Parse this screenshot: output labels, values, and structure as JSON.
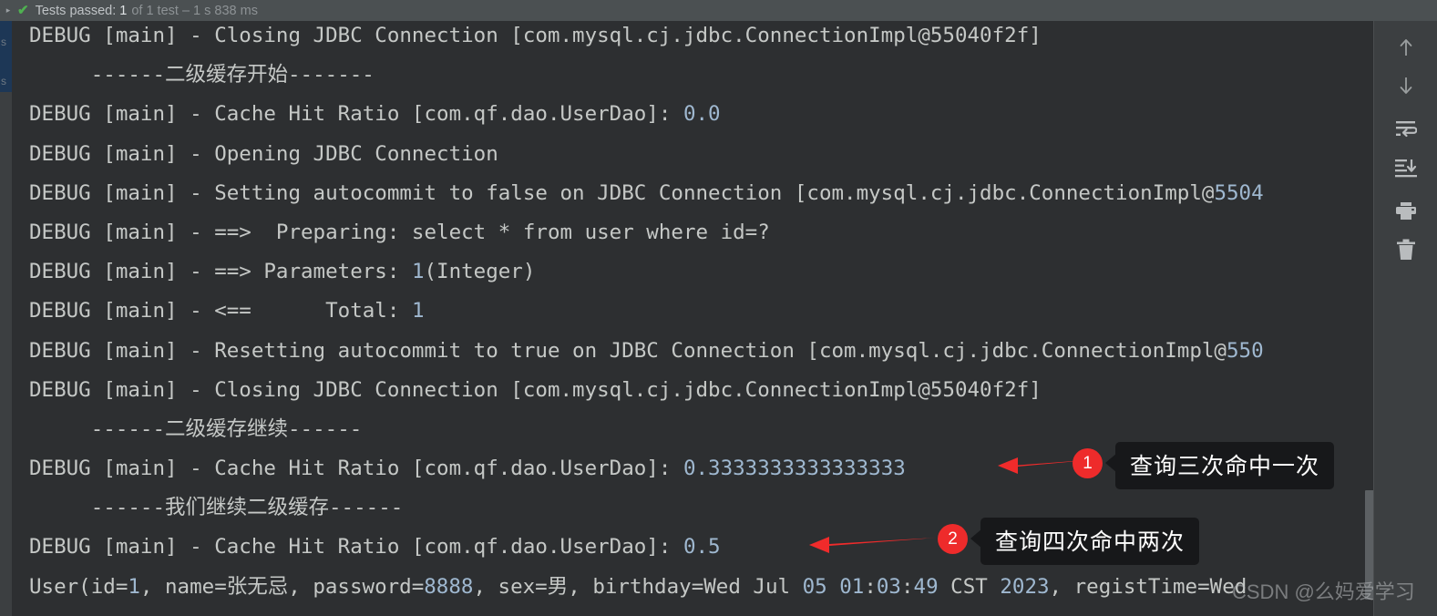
{
  "status_bar": {
    "caret_icon": "chevron-right-icon",
    "check_icon": "green-check-icon",
    "label": "Tests passed:",
    "count": "1",
    "detail": "of 1 test – 1 s 838 ms"
  },
  "gutter": {
    "ghost_marks": [
      "s",
      "s"
    ]
  },
  "console": {
    "lines": [
      "DEBUG [main] - Closing JDBC Connection [com.mysql.cj.jdbc.ConnectionImpl@55040f2f]",
      "     ------二级缓存开始-------",
      "DEBUG [main] - Cache Hit Ratio [com.qf.dao.UserDao]: 0.0",
      "DEBUG [main] - Opening JDBC Connection",
      "DEBUG [main] - Setting autocommit to false on JDBC Connection [com.mysql.cj.jdbc.ConnectionImpl@5504",
      "DEBUG [main] - ==>  Preparing: select * from user where id=?",
      "DEBUG [main] - ==> Parameters: 1(Integer)",
      "DEBUG [main] - <==      Total: 1",
      "DEBUG [main] - Resetting autocommit to true on JDBC Connection [com.mysql.cj.jdbc.ConnectionImpl@550",
      "DEBUG [main] - Closing JDBC Connection [com.mysql.cj.jdbc.ConnectionImpl@55040f2f]",
      "     ------二级缓存继续------",
      "DEBUG [main] - Cache Hit Ratio [com.qf.dao.UserDao]: 0.3333333333333333",
      "     ------我们继续二级缓存------",
      "DEBUG [main] - Cache Hit Ratio [com.qf.dao.UserDao]: 0.5",
      "User(id=1, name=张无忌, password=8888, sex=男, birthday=Wed Jul 05 01:03:49 CST 2023, registTime=Wed"
    ]
  },
  "toolbar": {
    "buttons": [
      {
        "icon": "arrow-up-icon",
        "name": "scroll-up-button"
      },
      {
        "icon": "arrow-down-icon",
        "name": "scroll-down-button"
      },
      {
        "icon": "soft-wrap-icon",
        "name": "soft-wrap-button"
      },
      {
        "icon": "scroll-to-end-icon",
        "name": "scroll-to-end-button"
      },
      {
        "icon": "print-icon",
        "name": "print-button"
      },
      {
        "icon": "trash-icon",
        "name": "clear-all-button"
      }
    ]
  },
  "annotations": [
    {
      "number": "1",
      "text": "查询三次命中一次"
    },
    {
      "number": "2",
      "text": "查询四次命中两次"
    }
  ],
  "watermark": {
    "text": "CSDN @么妈爱学习"
  },
  "colors": {
    "accent_red": "#ee2b2b",
    "console_bg": "#2d2f31",
    "chrome_bg": "#3c3f41",
    "status_bg": "#4b5052",
    "text": "#c5c8c6",
    "number": "#9fb8d0",
    "selection": "#1d3756"
  }
}
